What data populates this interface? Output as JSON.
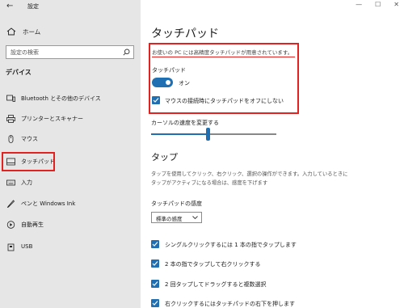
{
  "window": {
    "title": "設定",
    "controls": [
      "—",
      "☐",
      "✕"
    ]
  },
  "sidebar": {
    "home_label": "ホーム",
    "search_placeholder": "設定の検索",
    "section_title": "デバイス",
    "items": [
      {
        "label": "Bluetooth とその他のデバイス",
        "icon": "bluetooth-device-icon"
      },
      {
        "label": "プリンターとスキャナー",
        "icon": "printer-icon"
      },
      {
        "label": "マウス",
        "icon": "mouse-icon"
      },
      {
        "label": "タッチパッド",
        "icon": "touchpad-icon",
        "selected": true
      },
      {
        "label": "入力",
        "icon": "keyboard-icon"
      },
      {
        "label": "ペンと Windows Ink",
        "icon": "pen-icon"
      },
      {
        "label": "自動再生",
        "icon": "autoplay-icon"
      },
      {
        "label": "USB",
        "icon": "usb-icon"
      }
    ]
  },
  "main": {
    "page_title": "タッチパッド",
    "precision_message": "お使いの PC には高精度タッチパッドが用意されています。",
    "touchpad_label": "タッチパッド",
    "toggle_state": "オン",
    "keep_on_with_mouse": "マウスの接続時にタッチパッドをオフにしない",
    "cursor_speed_label": "カーソルの速度を変更する",
    "cursor_speed_fraction": 0.45,
    "tap_heading": "タップ",
    "tap_desc_line1": "タップを使用してクリック、右クリック、選択の操作ができます。入力しているときに",
    "tap_desc_line2": "タップがアクティブになる場合は、感度を下げます",
    "sensitivity_label": "タッチパッドの感度",
    "sensitivity_value": "標準の感度",
    "checkboxes": [
      "シングルクリックするには 1 本の指でタップします",
      "2 本の指でタップして右クリックする",
      "2 回タップしてドラッグすると複数選択",
      "右クリックするにはタッチパッドの右下を押します"
    ]
  },
  "colors": {
    "accent": "#1f6fb2",
    "highlight_red": "#e2221f",
    "sidebar_bg": "#e6e6e6"
  }
}
